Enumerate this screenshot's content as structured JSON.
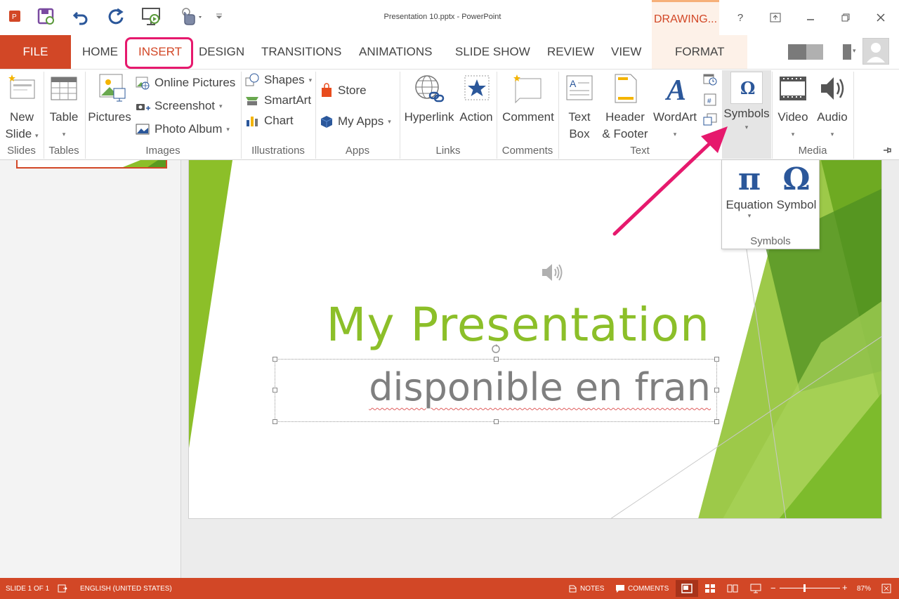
{
  "window": {
    "title": "Presentation 10.pptx - PowerPoint",
    "contextual_tab": "DRAWING...",
    "help": "?"
  },
  "tabs": {
    "file": "FILE",
    "home": "HOME",
    "insert": "INSERT",
    "design": "DESIGN",
    "transitions": "TRANSITIONS",
    "animations": "ANIMATIONS",
    "slide_show": "SLIDE SHOW",
    "review": "REVIEW",
    "view": "VIEW",
    "format": "FORMAT"
  },
  "ribbon": {
    "slides": {
      "new_slide_1": "New",
      "new_slide_2": "Slide",
      "label": "Slides"
    },
    "tables": {
      "table": "Table",
      "label": "Tables"
    },
    "images": {
      "pictures": "Pictures",
      "online_pictures": "Online Pictures",
      "screenshot": "Screenshot",
      "photo_album": "Photo Album",
      "label": "Images"
    },
    "illustrations": {
      "shapes": "Shapes",
      "smartart": "SmartArt",
      "chart": "Chart",
      "label": "Illustrations"
    },
    "apps": {
      "store": "Store",
      "my_apps": "My Apps",
      "label": "Apps"
    },
    "links": {
      "hyperlink": "Hyperlink",
      "action": "Action",
      "label": "Links"
    },
    "comments": {
      "comment": "Comment",
      "label": "Comments"
    },
    "text": {
      "text_box_1": "Text",
      "text_box_2": "Box",
      "header_1": "Header",
      "header_2": "& Footer",
      "wordart": "WordArt",
      "label": "Text"
    },
    "symbols": {
      "symbols": "Symbols"
    },
    "media": {
      "video": "Video",
      "audio": "Audio",
      "label": "Media"
    }
  },
  "symbols_dropdown": {
    "equation": "Equation",
    "symbol": "Symbol",
    "label": "Symbols"
  },
  "slide": {
    "title": "My Presentation",
    "subtitle": "disponible en fran"
  },
  "statusbar": {
    "slide_count": "SLIDE 1 OF 1",
    "language": "ENGLISH (UNITED STATES)",
    "notes": "NOTES",
    "comments": "COMMENTS",
    "zoom": "87%"
  },
  "colors": {
    "accent": "#d24726",
    "highlight": "#e6196d",
    "title_green": "#8cbf29",
    "icon_blue": "#2b579a"
  }
}
